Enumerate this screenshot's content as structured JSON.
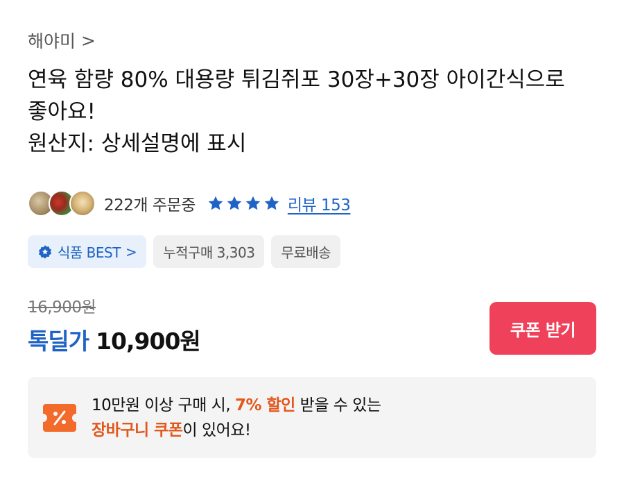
{
  "seller": {
    "name": "해야미",
    "chevron": ">"
  },
  "product": {
    "title_lines": [
      "연육 함량 80% 대용량 튀김쥐포 30장+30장 아이간식으로",
      "좋아요!",
      "원산지: 상세설명에 표시"
    ]
  },
  "social": {
    "order_count": "222개 주문중",
    "rating_stars": 4,
    "review_link": "리뷰 153",
    "star_color": "#1f63c6"
  },
  "badges": {
    "best_label": "식품 BEST",
    "best_chevron": ">",
    "cumulative": "누적구매 3,303",
    "shipping": "무료배송"
  },
  "pricing": {
    "original_price": "16,900원",
    "deal_label": "톡딜가",
    "deal_price": "10,900원",
    "accent_color": "#1f63c6"
  },
  "coupon_button": {
    "label": "쿠폰 받기",
    "color": "#f0415a"
  },
  "promo": {
    "line1_prefix": "10만원 이상 구매 시, ",
    "line1_highlight": "7% 할인",
    "line1_suffix": " 받을 수 있는",
    "line2_highlight": "장바구니 쿠폰",
    "line2_suffix": "이 있어요!",
    "highlight_color": "#e2571b",
    "icon": "coupon-percent-icon"
  }
}
